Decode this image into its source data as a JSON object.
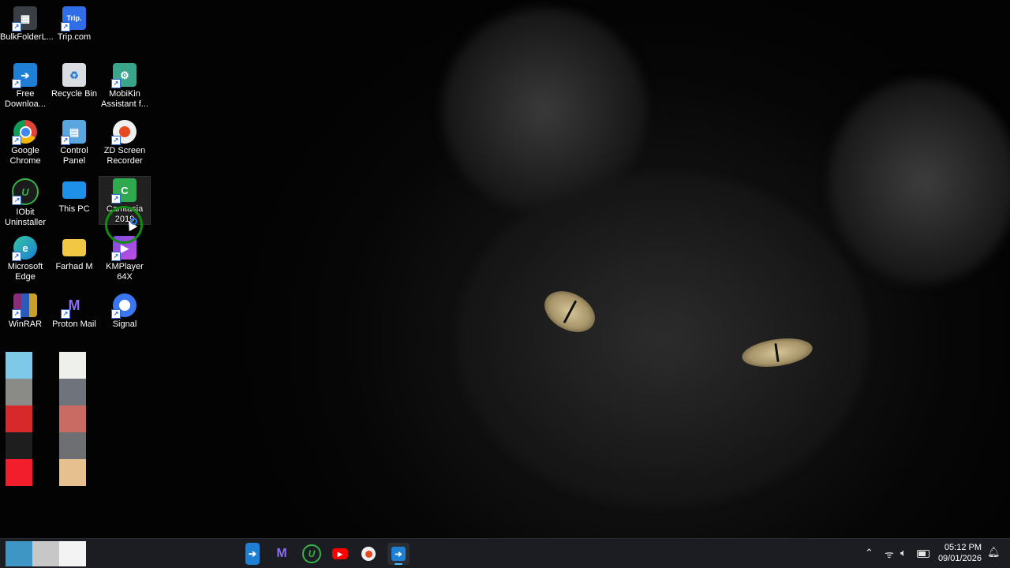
{
  "desktop": {
    "icons": [
      {
        "label": "BulkFolderL...",
        "icon": "bulk-folder-icon"
      },
      {
        "label": "Trip.com",
        "icon": "trip-com-icon",
        "badge": "Trip."
      },
      {
        "label": "Free Downloa...",
        "icon": "free-download-manager-icon"
      },
      {
        "label": "Recycle Bin",
        "icon": "recycle-bin-icon"
      },
      {
        "label": "MobiKin Assistant f...",
        "icon": "mobikin-icon"
      },
      {
        "label": "Google Chrome",
        "icon": "chrome-icon"
      },
      {
        "label": "Control Panel",
        "icon": "control-panel-icon"
      },
      {
        "label": "ZD Screen Recorder",
        "icon": "zd-recorder-icon"
      },
      {
        "label": "IObit Uninstaller",
        "icon": "iobit-icon"
      },
      {
        "label": "This PC",
        "icon": "this-pc-icon"
      },
      {
        "label": "Camtasia 2019",
        "icon": "camtasia-icon"
      },
      {
        "label": "Microsoft Edge",
        "icon": "edge-icon"
      },
      {
        "label": "Farhad M",
        "icon": "folder-icon"
      },
      {
        "label": "KMPlayer 64X",
        "icon": "kmplayer-icon"
      },
      {
        "label": "WinRAR",
        "icon": "winrar-icon"
      },
      {
        "label": "Proton Mail",
        "icon": "proton-mail-icon"
      },
      {
        "label": "Signal",
        "icon": "signal-icon"
      }
    ],
    "swatches_left": [
      "#7ec8e8",
      "#8a8a86",
      "#d7282b",
      "#1e1e1e",
      "#f21e2c"
    ],
    "swatches_right": [
      "#eef0ec",
      "#6f737b",
      "#c96b63",
      "#6d6f73",
      "#e7c08f"
    ]
  },
  "taskbar": {
    "left_swatches": [
      "#3d96c4",
      "#c7c7c7",
      "#f3f3f3"
    ],
    "apps": [
      "free-download-manager-icon",
      "proton-mail-icon",
      "iobit-icon",
      "youtube-icon",
      "zd-recorder-icon",
      "free-download-manager-icon"
    ],
    "tray_icons": [
      "chevron-up-icon",
      "wifi-icon",
      "volume-icon",
      "battery-icon"
    ],
    "time": "05:12 PM",
    "date": "09/01/2026"
  }
}
